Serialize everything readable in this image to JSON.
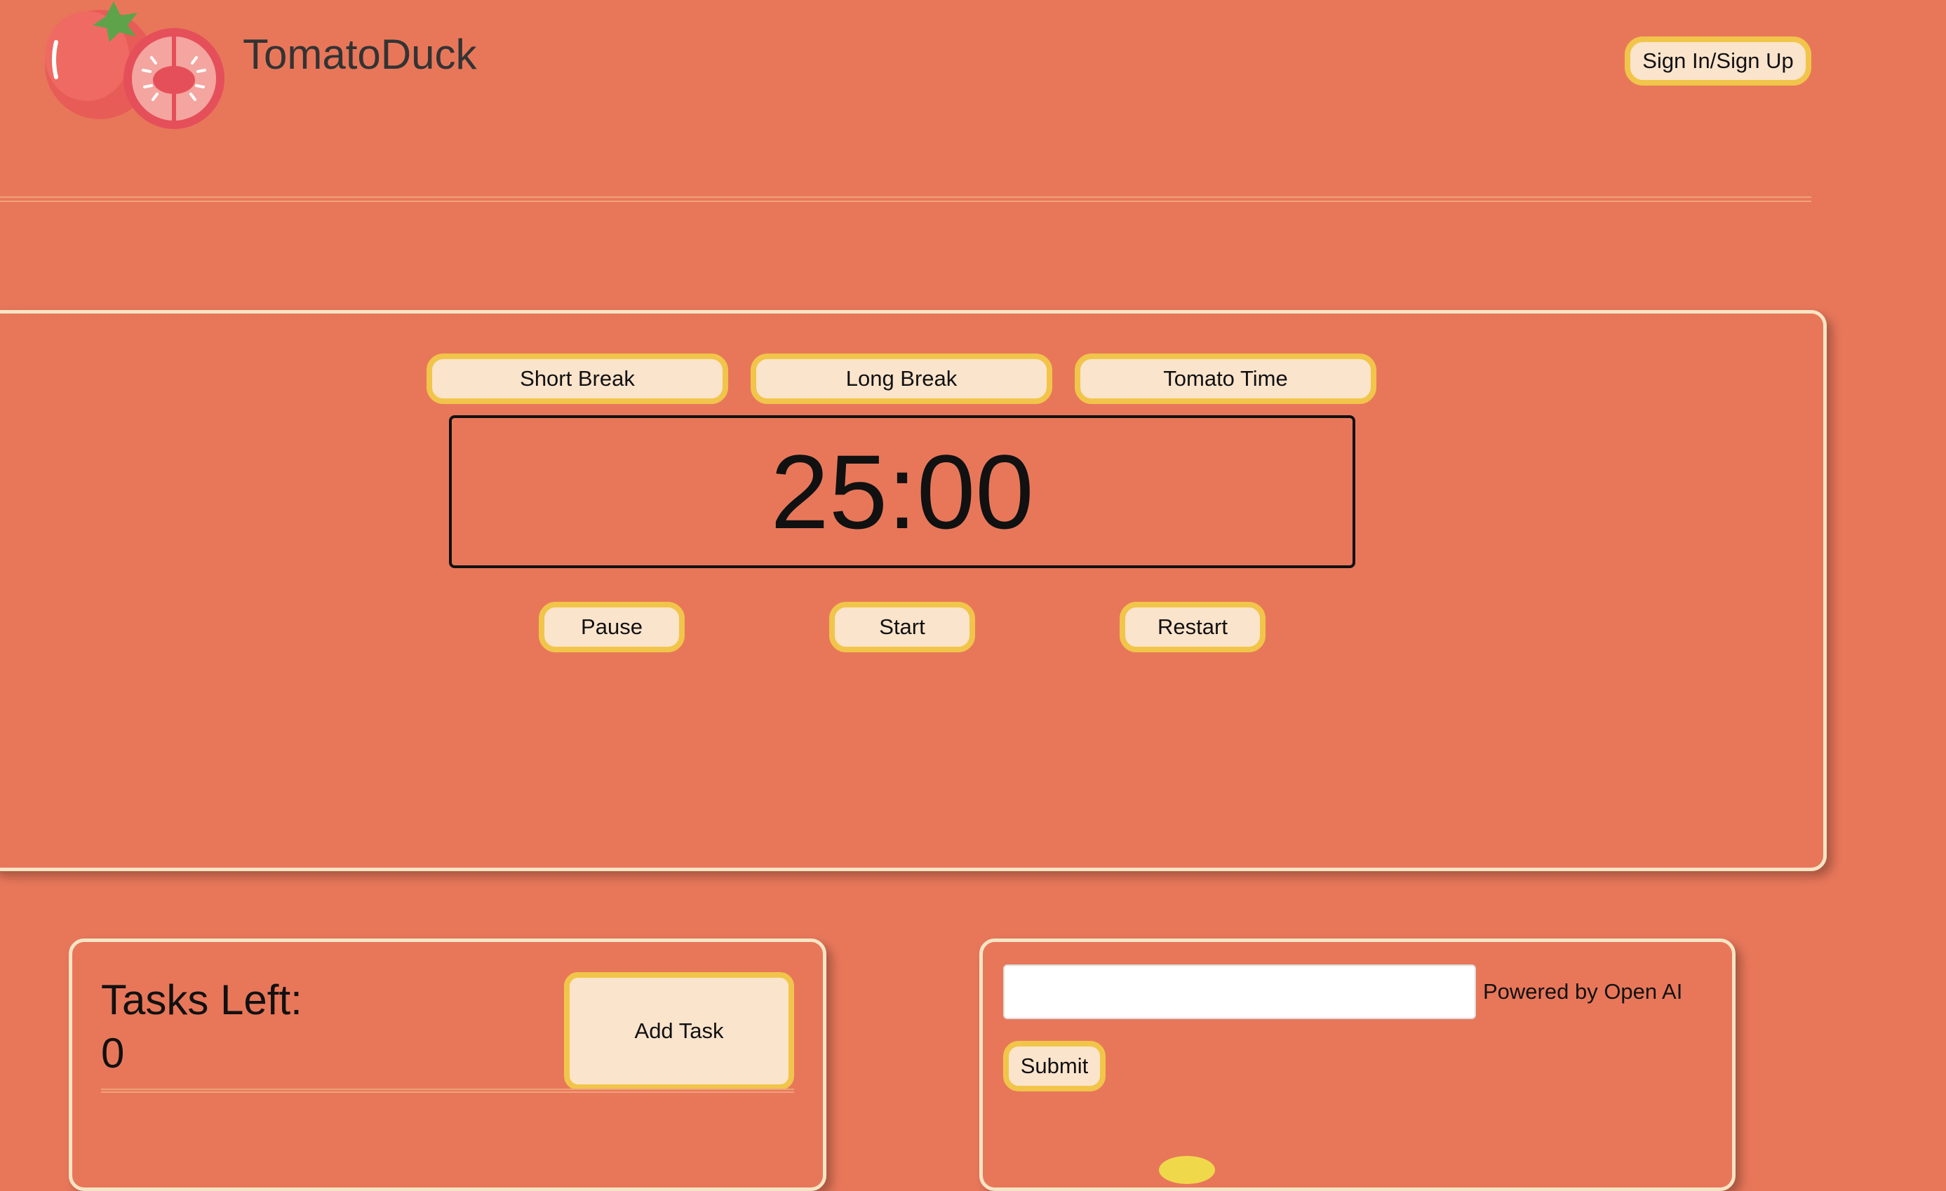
{
  "header": {
    "brand": "TomatoDuck",
    "auth_button": "Sign In/Sign Up",
    "logo_icon": "tomato-icon"
  },
  "timer": {
    "modes": [
      "Short Break",
      "Long Break",
      "Tomato Time"
    ],
    "display": "25:00",
    "controls": {
      "pause": "Pause",
      "start": "Start",
      "restart": "Restart"
    }
  },
  "tasks": {
    "title": "Tasks Left:",
    "count": "0",
    "add_button": "Add Task"
  },
  "ai": {
    "input_value": "",
    "input_placeholder": "",
    "powered_by": "Powered by Open AI",
    "submit_label": "Submit"
  },
  "colors": {
    "background": "#e8775a",
    "button_fill": "#fbe4cc",
    "button_border": "#f1c54a",
    "card_border": "#f6e5c4"
  }
}
